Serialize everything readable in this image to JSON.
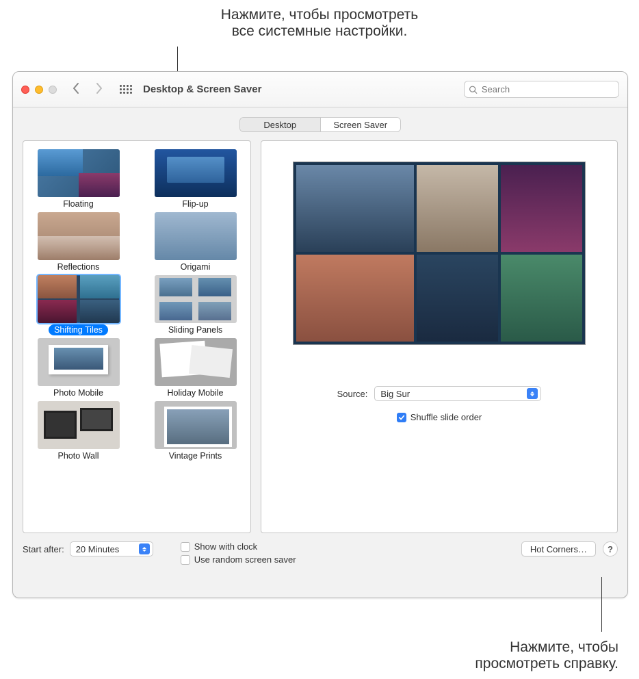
{
  "callouts": {
    "top_line1": "Нажмите, чтобы просмотреть",
    "top_line2": "все системные настройки.",
    "bottom_line1": "Нажмите, чтобы",
    "bottom_line2": "просмотреть справку."
  },
  "window": {
    "title": "Desktop & Screen Saver",
    "search_placeholder": "Search",
    "tabs": {
      "desktop": "Desktop",
      "screen_saver": "Screen Saver"
    }
  },
  "screensavers": [
    {
      "label": "Floating"
    },
    {
      "label": "Flip-up"
    },
    {
      "label": "Reflections"
    },
    {
      "label": "Origami"
    },
    {
      "label": "Shifting Tiles",
      "selected": true
    },
    {
      "label": "Sliding Panels"
    },
    {
      "label": "Photo Mobile"
    },
    {
      "label": "Holiday Mobile"
    },
    {
      "label": "Photo Wall"
    },
    {
      "label": "Vintage Prints"
    }
  ],
  "source": {
    "label": "Source:",
    "value": "Big Sur",
    "shuffle_label": "Shuffle slide order",
    "shuffle_checked": true
  },
  "footer": {
    "start_after_label": "Start after:",
    "start_after_value": "20 Minutes",
    "show_clock_label": "Show with clock",
    "random_label": "Use random screen saver",
    "hot_corners_label": "Hot Corners…",
    "help_glyph": "?"
  }
}
